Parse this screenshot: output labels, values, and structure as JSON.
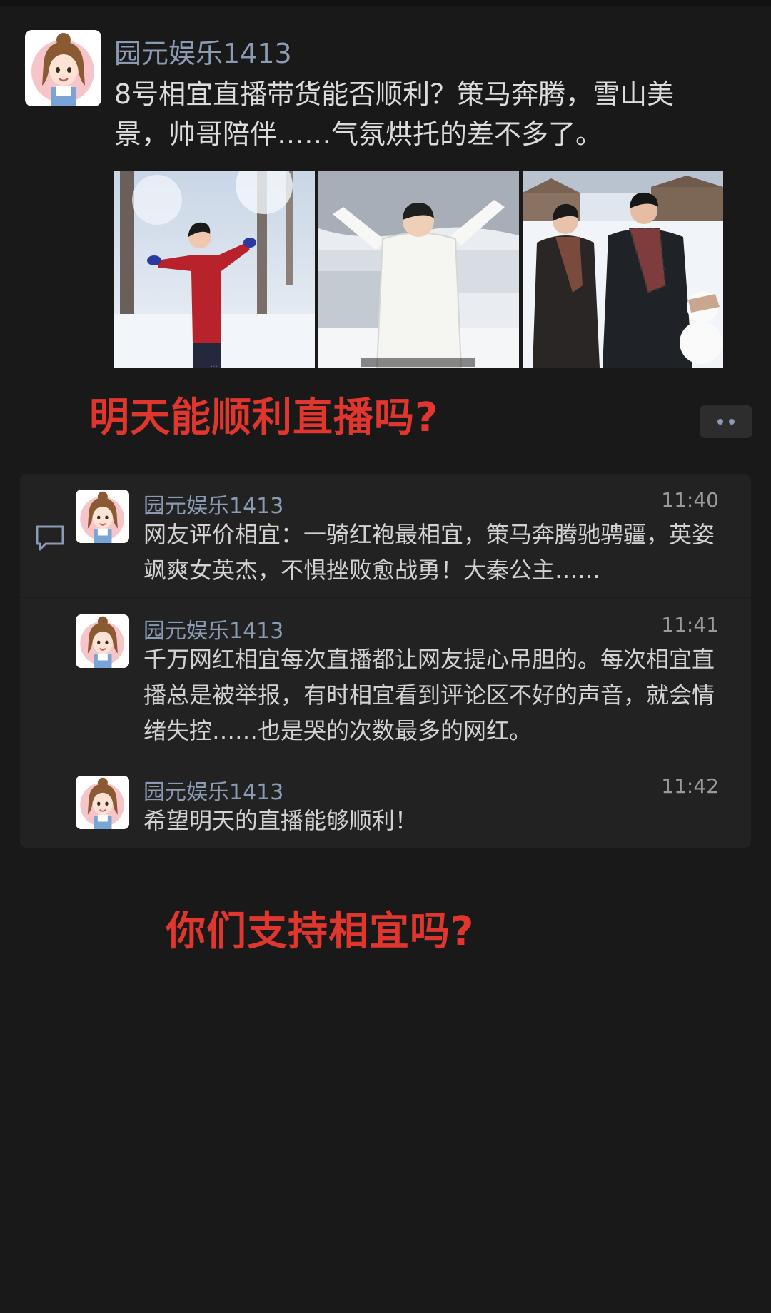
{
  "post": {
    "author": "园元娱乐1413",
    "text": "8号相宜直播带货能否顺利？策马奔腾，雪山美景，帅哥陪伴……气氛烘托的差不多了。",
    "photos": [
      {
        "icon": "photo-red-jacket-snow-forest"
      },
      {
        "icon": "photo-white-coat-snow-hill"
      },
      {
        "icon": "photo-couple-snow-village"
      }
    ]
  },
  "overlay": {
    "heading_1": "明天能顺利直播吗?",
    "heading_2": "你们支持相宜吗?"
  },
  "comments": [
    {
      "author": "园元娱乐1413",
      "time": "11:40",
      "text": "网友评价相宜：一骑红袍最相宜，策马奔腾驰骋疆，英姿飒爽女英杰，不惧挫败愈战勇！大秦公主……"
    },
    {
      "author": "园元娱乐1413",
      "time": "11:41",
      "text": "千万网红相宜每次直播都让网友提心吊胆的。每次相宜直播总是被举报，有时相宜看到评论区不好的声音，就会情绪失控……也是哭的次数最多的网红。"
    },
    {
      "author": "园元娱乐1413",
      "time": "11:42",
      "text": "希望明天的直播能够顺利！"
    }
  ],
  "colors": {
    "background": "#191919",
    "name": "#8b9bb4",
    "overlay_red": "#e0362e",
    "comment_panel": "#222222"
  }
}
